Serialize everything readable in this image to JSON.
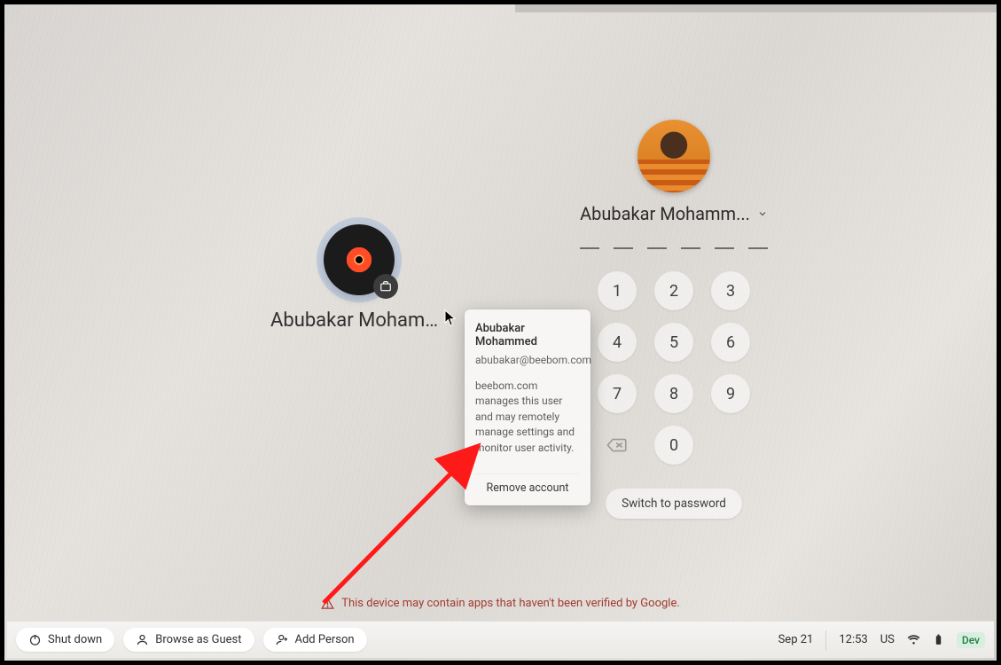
{
  "user_secondary": {
    "display_name": "Abubakar Mohamm...",
    "enterprise_icon": "briefcase-icon"
  },
  "popover": {
    "full_name": "Abubakar Mohammed",
    "email": "abubakar@beebom.com",
    "management_note": "beebom.com manages this user and may remotely manage settings and monitor user activity.",
    "remove_label": "Remove account"
  },
  "panel": {
    "display_name": "Abubakar Mohamm...",
    "pin_slots": 6,
    "keys": [
      "1",
      "2",
      "3",
      "4",
      "5",
      "6",
      "7",
      "8",
      "9",
      "",
      "0",
      ""
    ],
    "switch_label": "Switch to password"
  },
  "warning": {
    "text": "This device may contain apps that haven't been verified by Google."
  },
  "shelf": {
    "shutdown": "Shut down",
    "guest": "Browse as Guest",
    "add_person": "Add Person",
    "date": "Sep 21",
    "time": "12:53",
    "locale": "US",
    "dev": "Dev"
  }
}
